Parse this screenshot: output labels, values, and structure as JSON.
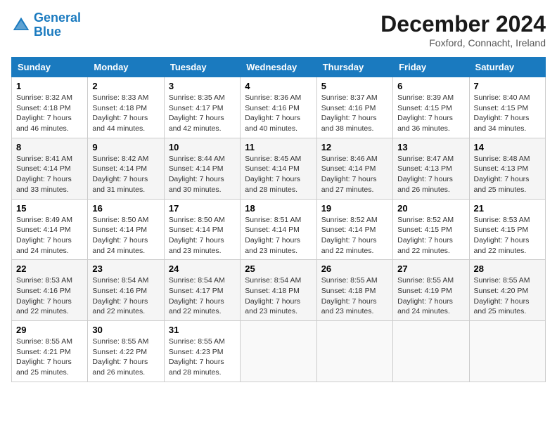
{
  "logo": {
    "line1": "General",
    "line2": "Blue"
  },
  "title": "December 2024",
  "subtitle": "Foxford, Connacht, Ireland",
  "headers": [
    "Sunday",
    "Monday",
    "Tuesday",
    "Wednesday",
    "Thursday",
    "Friday",
    "Saturday"
  ],
  "weeks": [
    [
      {
        "day": "1",
        "sunrise": "8:32 AM",
        "sunset": "4:18 PM",
        "daylight": "7 hours and 46 minutes."
      },
      {
        "day": "2",
        "sunrise": "8:33 AM",
        "sunset": "4:18 PM",
        "daylight": "7 hours and 44 minutes."
      },
      {
        "day": "3",
        "sunrise": "8:35 AM",
        "sunset": "4:17 PM",
        "daylight": "7 hours and 42 minutes."
      },
      {
        "day": "4",
        "sunrise": "8:36 AM",
        "sunset": "4:16 PM",
        "daylight": "7 hours and 40 minutes."
      },
      {
        "day": "5",
        "sunrise": "8:37 AM",
        "sunset": "4:16 PM",
        "daylight": "7 hours and 38 minutes."
      },
      {
        "day": "6",
        "sunrise": "8:39 AM",
        "sunset": "4:15 PM",
        "daylight": "7 hours and 36 minutes."
      },
      {
        "day": "7",
        "sunrise": "8:40 AM",
        "sunset": "4:15 PM",
        "daylight": "7 hours and 34 minutes."
      }
    ],
    [
      {
        "day": "8",
        "sunrise": "8:41 AM",
        "sunset": "4:14 PM",
        "daylight": "7 hours and 33 minutes."
      },
      {
        "day": "9",
        "sunrise": "8:42 AM",
        "sunset": "4:14 PM",
        "daylight": "7 hours and 31 minutes."
      },
      {
        "day": "10",
        "sunrise": "8:44 AM",
        "sunset": "4:14 PM",
        "daylight": "7 hours and 30 minutes."
      },
      {
        "day": "11",
        "sunrise": "8:45 AM",
        "sunset": "4:14 PM",
        "daylight": "7 hours and 28 minutes."
      },
      {
        "day": "12",
        "sunrise": "8:46 AM",
        "sunset": "4:14 PM",
        "daylight": "7 hours and 27 minutes."
      },
      {
        "day": "13",
        "sunrise": "8:47 AM",
        "sunset": "4:13 PM",
        "daylight": "7 hours and 26 minutes."
      },
      {
        "day": "14",
        "sunrise": "8:48 AM",
        "sunset": "4:13 PM",
        "daylight": "7 hours and 25 minutes."
      }
    ],
    [
      {
        "day": "15",
        "sunrise": "8:49 AM",
        "sunset": "4:14 PM",
        "daylight": "7 hours and 24 minutes."
      },
      {
        "day": "16",
        "sunrise": "8:50 AM",
        "sunset": "4:14 PM",
        "daylight": "7 hours and 24 minutes."
      },
      {
        "day": "17",
        "sunrise": "8:50 AM",
        "sunset": "4:14 PM",
        "daylight": "7 hours and 23 minutes."
      },
      {
        "day": "18",
        "sunrise": "8:51 AM",
        "sunset": "4:14 PM",
        "daylight": "7 hours and 23 minutes."
      },
      {
        "day": "19",
        "sunrise": "8:52 AM",
        "sunset": "4:14 PM",
        "daylight": "7 hours and 22 minutes."
      },
      {
        "day": "20",
        "sunrise": "8:52 AM",
        "sunset": "4:15 PM",
        "daylight": "7 hours and 22 minutes."
      },
      {
        "day": "21",
        "sunrise": "8:53 AM",
        "sunset": "4:15 PM",
        "daylight": "7 hours and 22 minutes."
      }
    ],
    [
      {
        "day": "22",
        "sunrise": "8:53 AM",
        "sunset": "4:16 PM",
        "daylight": "7 hours and 22 minutes."
      },
      {
        "day": "23",
        "sunrise": "8:54 AM",
        "sunset": "4:16 PM",
        "daylight": "7 hours and 22 minutes."
      },
      {
        "day": "24",
        "sunrise": "8:54 AM",
        "sunset": "4:17 PM",
        "daylight": "7 hours and 22 minutes."
      },
      {
        "day": "25",
        "sunrise": "8:54 AM",
        "sunset": "4:18 PM",
        "daylight": "7 hours and 23 minutes."
      },
      {
        "day": "26",
        "sunrise": "8:55 AM",
        "sunset": "4:18 PM",
        "daylight": "7 hours and 23 minutes."
      },
      {
        "day": "27",
        "sunrise": "8:55 AM",
        "sunset": "4:19 PM",
        "daylight": "7 hours and 24 minutes."
      },
      {
        "day": "28",
        "sunrise": "8:55 AM",
        "sunset": "4:20 PM",
        "daylight": "7 hours and 25 minutes."
      }
    ],
    [
      {
        "day": "29",
        "sunrise": "8:55 AM",
        "sunset": "4:21 PM",
        "daylight": "7 hours and 25 minutes."
      },
      {
        "day": "30",
        "sunrise": "8:55 AM",
        "sunset": "4:22 PM",
        "daylight": "7 hours and 26 minutes."
      },
      {
        "day": "31",
        "sunrise": "8:55 AM",
        "sunset": "4:23 PM",
        "daylight": "7 hours and 28 minutes."
      },
      null,
      null,
      null,
      null
    ]
  ]
}
